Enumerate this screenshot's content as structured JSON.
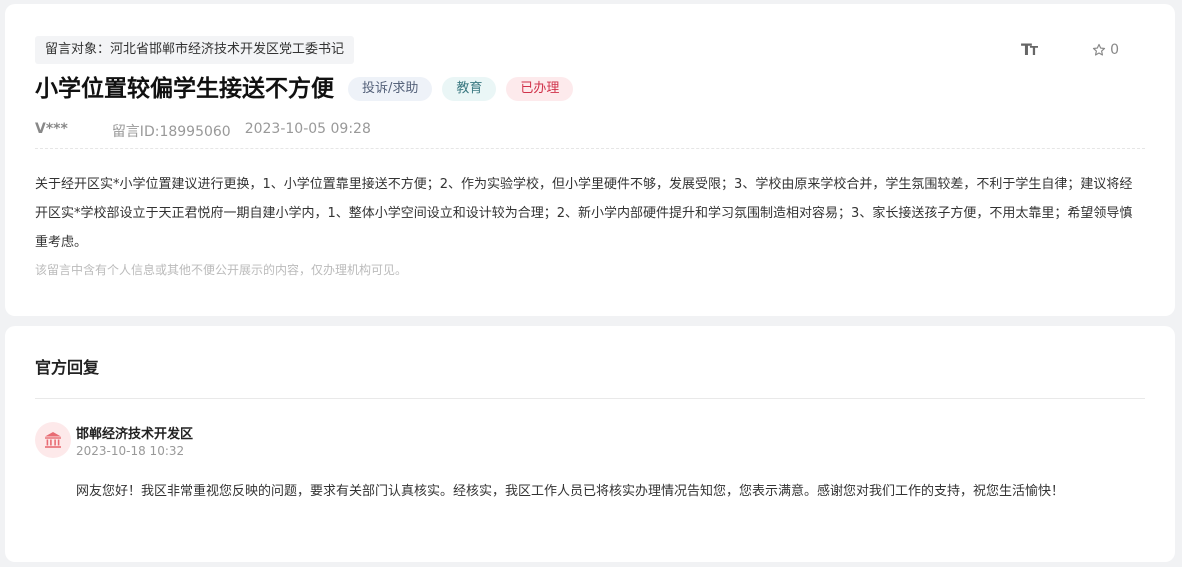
{
  "message": {
    "recipient": "留言对象：河北省邯郸市经济技术开发区党工委书记",
    "title": "小学位置较偏学生接送不方便",
    "tags": {
      "type": "投诉/求助",
      "category": "教育",
      "status": "已办理"
    },
    "author": "V***",
    "message_id": "留言ID:18995060",
    "date": "2023-10-05 09:28",
    "font_size_icon_main": "T",
    "font_size_icon_sub": "T",
    "favorite_count": "0",
    "content": "关于经开区实*小学位置建议进行更换，1、小学位置靠里接送不方便；2、作为实验学校，但小学里硬件不够，发展受限；3、学校由原来学校合并，学生氛围较差，不利于学生自律；建议将经开区实*学校部设立于天正君悦府一期自建小学内，1、整体小学空间设立和设计较为合理；2、新小学内部硬件提升和学习氛围制造相对容易；3、家长接送孩子方便，不用太靠里；希望领导慎重考虑。",
    "privacy_note": "该留言中含有个人信息或其他不便公开展示的内容，仅办理机构可见。"
  },
  "reply": {
    "heading": "官方回复",
    "org_name": "邯郸经济技术开发区",
    "date": "2023-10-18 10:32",
    "text": "网友您好！我区非常重视您反映的问题，要求有关部门认真核实。经核实，我区工作人员已将核实办理情况告知您，您表示满意。感谢您对我们工作的支持，祝您生活愉快！"
  },
  "colors": {
    "accent_red": "#d0324a",
    "org_icon_red": "#e86b73"
  }
}
